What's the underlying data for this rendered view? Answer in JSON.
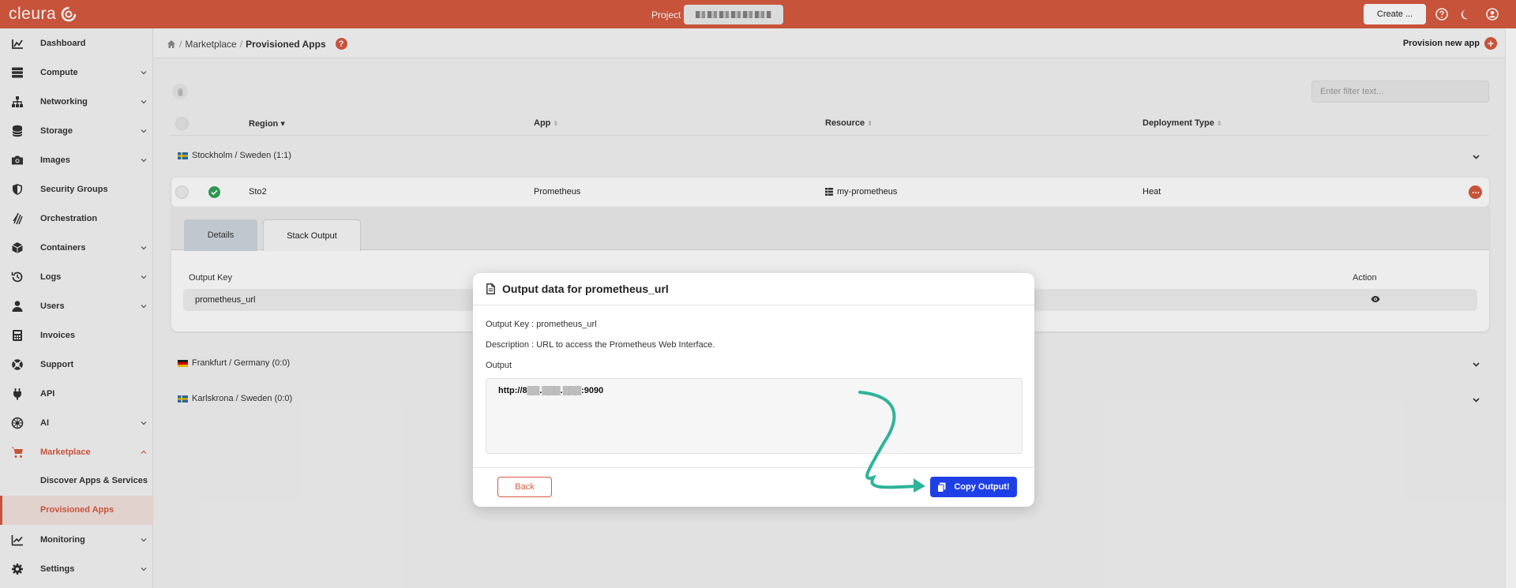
{
  "app": {
    "brand": "cleura",
    "project_label": "Project",
    "create_label": "Create ...",
    "accent": "#d75a3f"
  },
  "sidebar": {
    "items": [
      {
        "label": "Dashboard",
        "icon": "chart-icon"
      },
      {
        "label": "Compute",
        "icon": "server-icon"
      },
      {
        "label": "Networking",
        "icon": "network-icon"
      },
      {
        "label": "Storage",
        "icon": "database-icon"
      },
      {
        "label": "Images",
        "icon": "camera-icon"
      },
      {
        "label": "Security Groups",
        "icon": "shield-icon"
      },
      {
        "label": "Orchestration",
        "icon": "layers-icon"
      },
      {
        "label": "Containers",
        "icon": "cube-icon"
      },
      {
        "label": "Logs",
        "icon": "history-icon"
      },
      {
        "label": "Users",
        "icon": "user-icon"
      },
      {
        "label": "Invoices",
        "icon": "calculator-icon"
      },
      {
        "label": "Support",
        "icon": "lifebuoy-icon"
      },
      {
        "label": "API",
        "icon": "plug-icon"
      },
      {
        "label": "AI",
        "icon": "ai-icon"
      },
      {
        "label": "Marketplace",
        "icon": "cart-icon"
      },
      {
        "label": "Monitoring",
        "icon": "trend-icon"
      },
      {
        "label": "Settings",
        "icon": "gear-icon"
      }
    ],
    "marketplace_sub": [
      {
        "label": "Discover Apps & Services"
      },
      {
        "label": "Provisioned Apps"
      }
    ]
  },
  "header": {
    "crumbs": [
      "Marketplace",
      "Provisioned Apps"
    ],
    "provision_new": "Provision new app"
  },
  "filter": {
    "placeholder": "Enter filter text..."
  },
  "table": {
    "columns": [
      "Region",
      "App",
      "Resource",
      "Deployment Type"
    ],
    "groups": [
      {
        "label": "Stockholm / Sweden",
        "count": "(1:1)"
      },
      {
        "label": "Frankfurt / Germany",
        "count": "(0:0)"
      },
      {
        "label": "Karlskrona / Sweden",
        "count": "(0:0)"
      }
    ],
    "row": {
      "region": "Sto2",
      "app": "Prometheus",
      "resource": "my-prometheus",
      "deployment": "Heat"
    }
  },
  "detail": {
    "tabs": [
      "Details",
      "Stack Output"
    ],
    "output_key_header": "Output Key",
    "action_header": "Action",
    "output_key": "prometheus_url"
  },
  "modal": {
    "title": "Output data for prometheus_url",
    "key_line": "Output Key : prometheus_url",
    "desc_line": "Description : URL to access the Prometheus Web Interface.",
    "output_label": "Output",
    "output_value": "http://8▒▒.▒▒▒.▒▒▒:9090",
    "back": "Back",
    "copy": "Copy Output!"
  }
}
